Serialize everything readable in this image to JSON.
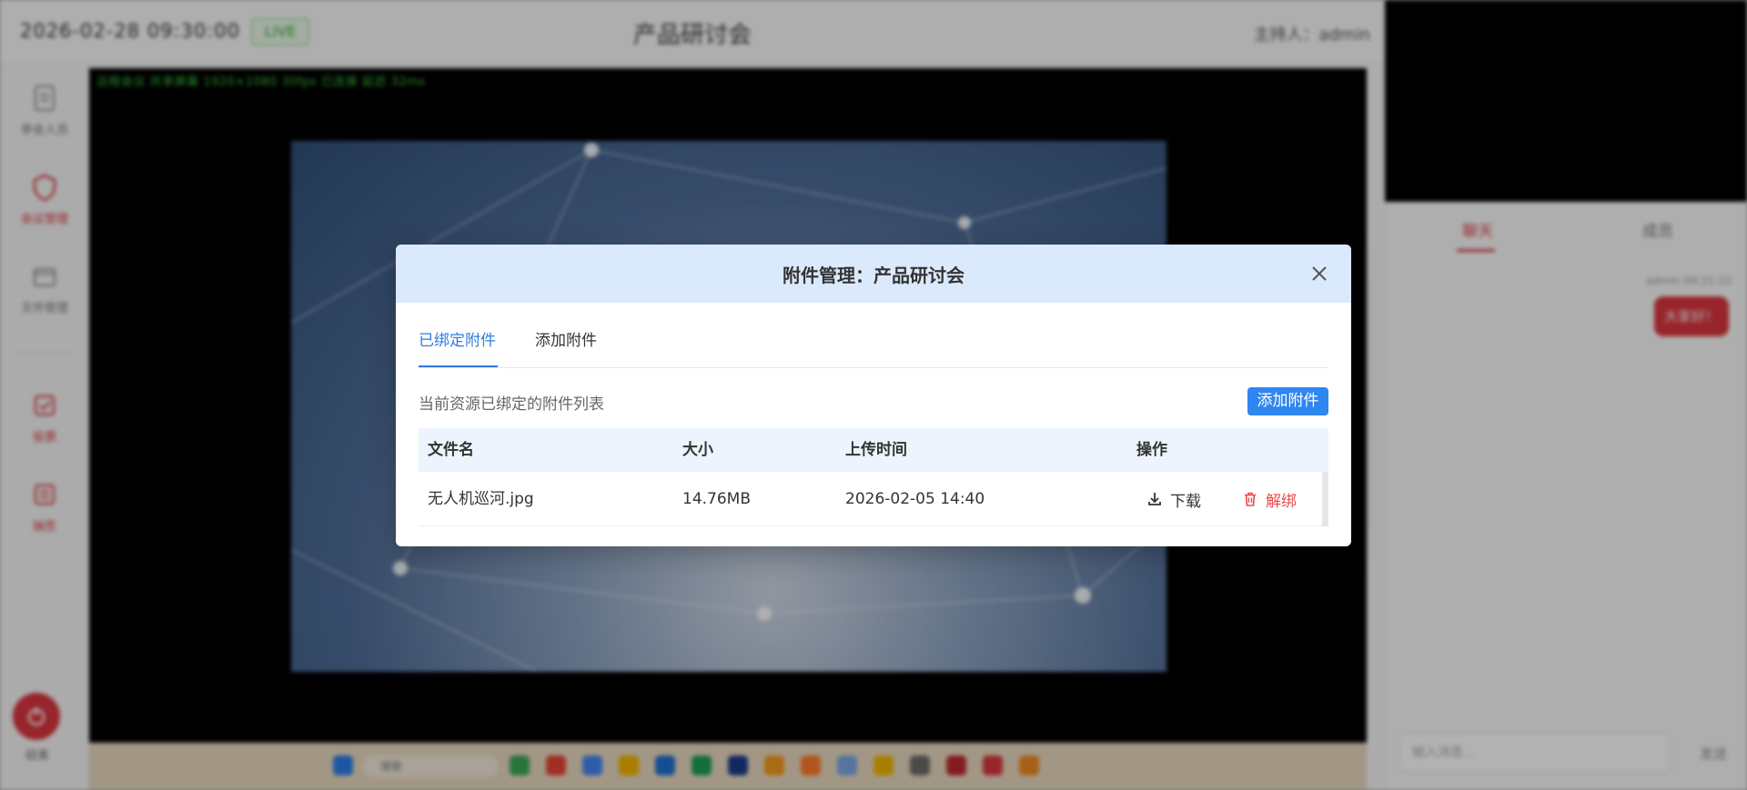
{
  "header": {
    "datetime": "2026-02-28 09:30:00",
    "live_badge": "LIVE",
    "meeting_title": "产品研讨会",
    "host": "主持人：admin"
  },
  "left_rail": {
    "items": [
      {
        "label": "参会人员",
        "icon": "document-icon"
      },
      {
        "label": "会议管理",
        "icon": "shield-icon"
      },
      {
        "label": "文件管理",
        "icon": "folder-icon"
      },
      {
        "label": "投票",
        "icon": "vote-icon"
      },
      {
        "label": "抽签",
        "icon": "lottery-icon"
      }
    ],
    "end_label": "结束"
  },
  "stage": {
    "info_line": "远程会议 共享屏幕 1920×1080 30fps 已连接 延迟 32ms"
  },
  "taskbar": {
    "search_placeholder": "搜索",
    "app_colors": [
      "#3aa757",
      "#e94235",
      "#4285f4",
      "#f4b400",
      "#1f6fd1",
      "#1e9e56",
      "#1a3a8a",
      "#f49b1a",
      "#ff7b2c",
      "#7aa6e6",
      "#f2b600",
      "#6b6b6b",
      "#c1272d",
      "#d9363e",
      "#f08a24"
    ]
  },
  "right_panel": {
    "tabs": [
      "聊天",
      "成员"
    ],
    "message_time": "admin 09:31:22",
    "message_text": "大家好！",
    "input_placeholder": "输入消息...",
    "send_label": "发送"
  },
  "modal": {
    "title": "附件管理：产品研讨会",
    "tabs": [
      "已绑定附件",
      "添加附件"
    ],
    "active_tab": 0,
    "list_description": "当前资源已绑定的附件列表",
    "add_button": "添加附件",
    "columns": [
      "文件名",
      "大小",
      "上传时间",
      "操作"
    ],
    "rows": [
      {
        "filename": "无人机巡河.jpg",
        "size": "14.76MB",
        "uploaded_at": "2026-02-05 14:40",
        "download_label": "下载",
        "unbind_label": "解绑"
      }
    ],
    "colors": {
      "accent": "#2f86f0",
      "header_bg": "#dbe9fc",
      "danger": "#ec4a4a"
    }
  }
}
